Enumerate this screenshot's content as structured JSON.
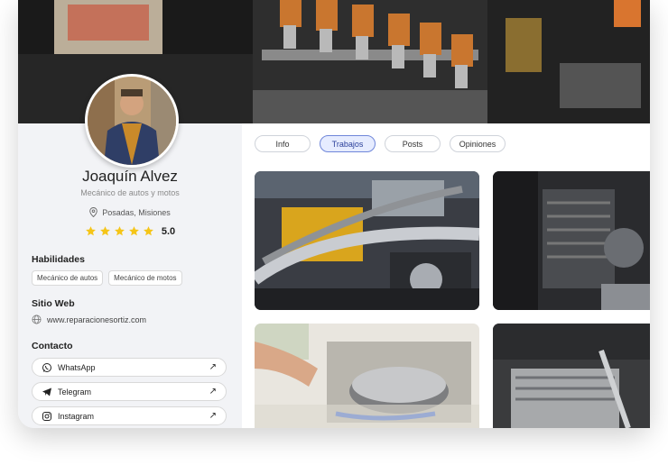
{
  "profile": {
    "name": "Joaquín Alvez",
    "title": "Mecánico de autos y motos",
    "location": "Posadas, Misiones",
    "rating": "5.0",
    "stars": 5
  },
  "skills": {
    "heading": "Habilidades",
    "items": [
      "Mecánico de autos",
      "Mecánico de motos"
    ]
  },
  "website": {
    "heading": "Sitio Web",
    "url": "www.reparacionesortiz.com"
  },
  "contact": {
    "heading": "Contacto",
    "items": [
      {
        "label": "WhatsApp",
        "icon": "whatsapp-icon"
      },
      {
        "label": "Telegram",
        "icon": "telegram-icon"
      },
      {
        "label": "Instagram",
        "icon": "instagram-icon"
      }
    ]
  },
  "tabs": [
    {
      "label": "Info",
      "active": false
    },
    {
      "label": "Trabajos",
      "active": true
    },
    {
      "label": "Posts",
      "active": false
    },
    {
      "label": "Opiniones",
      "active": false
    }
  ],
  "colors": {
    "accent": "#6f86d9",
    "star": "#f5c518",
    "sidebar_bg": "#f2f3f6"
  }
}
